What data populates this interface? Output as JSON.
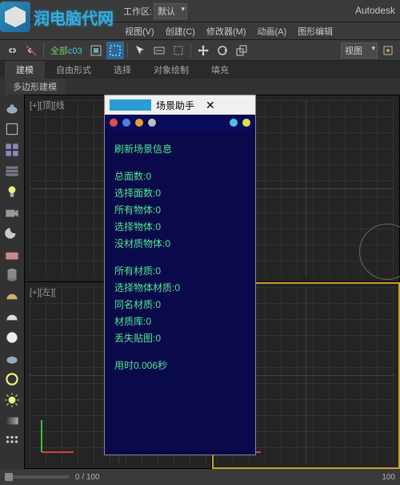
{
  "watermark": "润电脑代网",
  "workspace_label": "工作区: ",
  "workspace_value": "默认",
  "app_brand": "Autodesk",
  "menu": {
    "view": "视图(V)",
    "create": "创建(C)",
    "modifier": "修改器(M)",
    "anim": "动画(A)",
    "gfx": "图形编辑"
  },
  "toolbar_text": {
    "all": "全部",
    "code": "c03"
  },
  "view_combo": "视图",
  "tabs": {
    "model": "建模",
    "free": "自由形式",
    "select": "选择",
    "objpaint": "对象绘制",
    "fill": "填充"
  },
  "subtab": "多边形建模",
  "viewport": {
    "tl": "[+][顶][线",
    "bl": "[+][左][",
    "br": ""
  },
  "status": {
    "frame": "0 / 100",
    "frame_end": "100"
  },
  "popup": {
    "title": "场景助手",
    "refresh": "刷新场景信息",
    "faces": "总面数:0",
    "sel_faces": "选择面数:0",
    "all_obj": "所有物体:0",
    "sel_obj": "选择物体:0",
    "nomat_obj": "没材质物体:0",
    "all_mat": "所有材质:0",
    "sel_mat": "选择物体材质:0",
    "same_mat": "同名材质:0",
    "mat_lib": "材质库:0",
    "miss_tex": "丢失贴图:0",
    "time": "用时0.006秒"
  }
}
